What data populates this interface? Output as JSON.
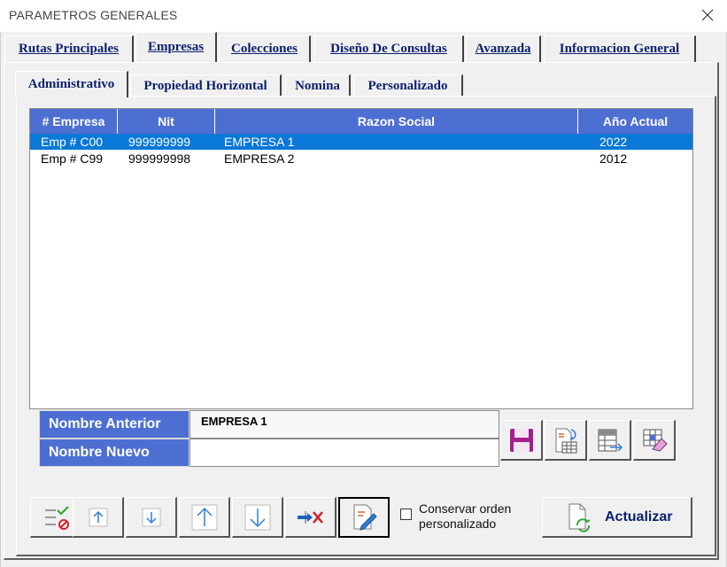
{
  "window": {
    "title": "PARAMETROS GENERALES",
    "close_icon": "close-icon"
  },
  "tabs": [
    {
      "label": "Rutas Principales"
    },
    {
      "label": "Empresas",
      "active": true
    },
    {
      "label": "Colecciones"
    },
    {
      "label": "Diseño De Consultas"
    },
    {
      "label": "Avanzada"
    },
    {
      "label": "Informacion General"
    }
  ],
  "subtabs": [
    {
      "label": "Administrativo",
      "active": true
    },
    {
      "label": "Propiedad Horizontal"
    },
    {
      "label": "Nomina"
    },
    {
      "label": "Personalizado"
    }
  ],
  "grid": {
    "columns": [
      "# Empresa",
      "Nit",
      "Razon Social",
      "Año Actual"
    ],
    "rows": [
      {
        "empresa": "Emp # C00",
        "nit": "999999999",
        "razon": "EMPRESA 1",
        "anio": "2022",
        "selected": true
      },
      {
        "empresa": "Emp # C99",
        "nit": "999999998",
        "razon": "EMPRESA 2",
        "anio": "2012",
        "selected": false
      }
    ]
  },
  "rename": {
    "old_label": "Nombre Anterior",
    "old_value": "EMPRESA 1",
    "new_label": "Nombre Nuevo",
    "new_value": ""
  },
  "options": {
    "keep_order_label": "Conservar orden personalizado",
    "keep_order_checked": false
  },
  "actions": {
    "refresh_label": "Actualizar"
  },
  "colors": {
    "header_blue": "#4d6fd2",
    "selection_blue": "#0a78d7",
    "tab_text": "#0b1f6b"
  }
}
